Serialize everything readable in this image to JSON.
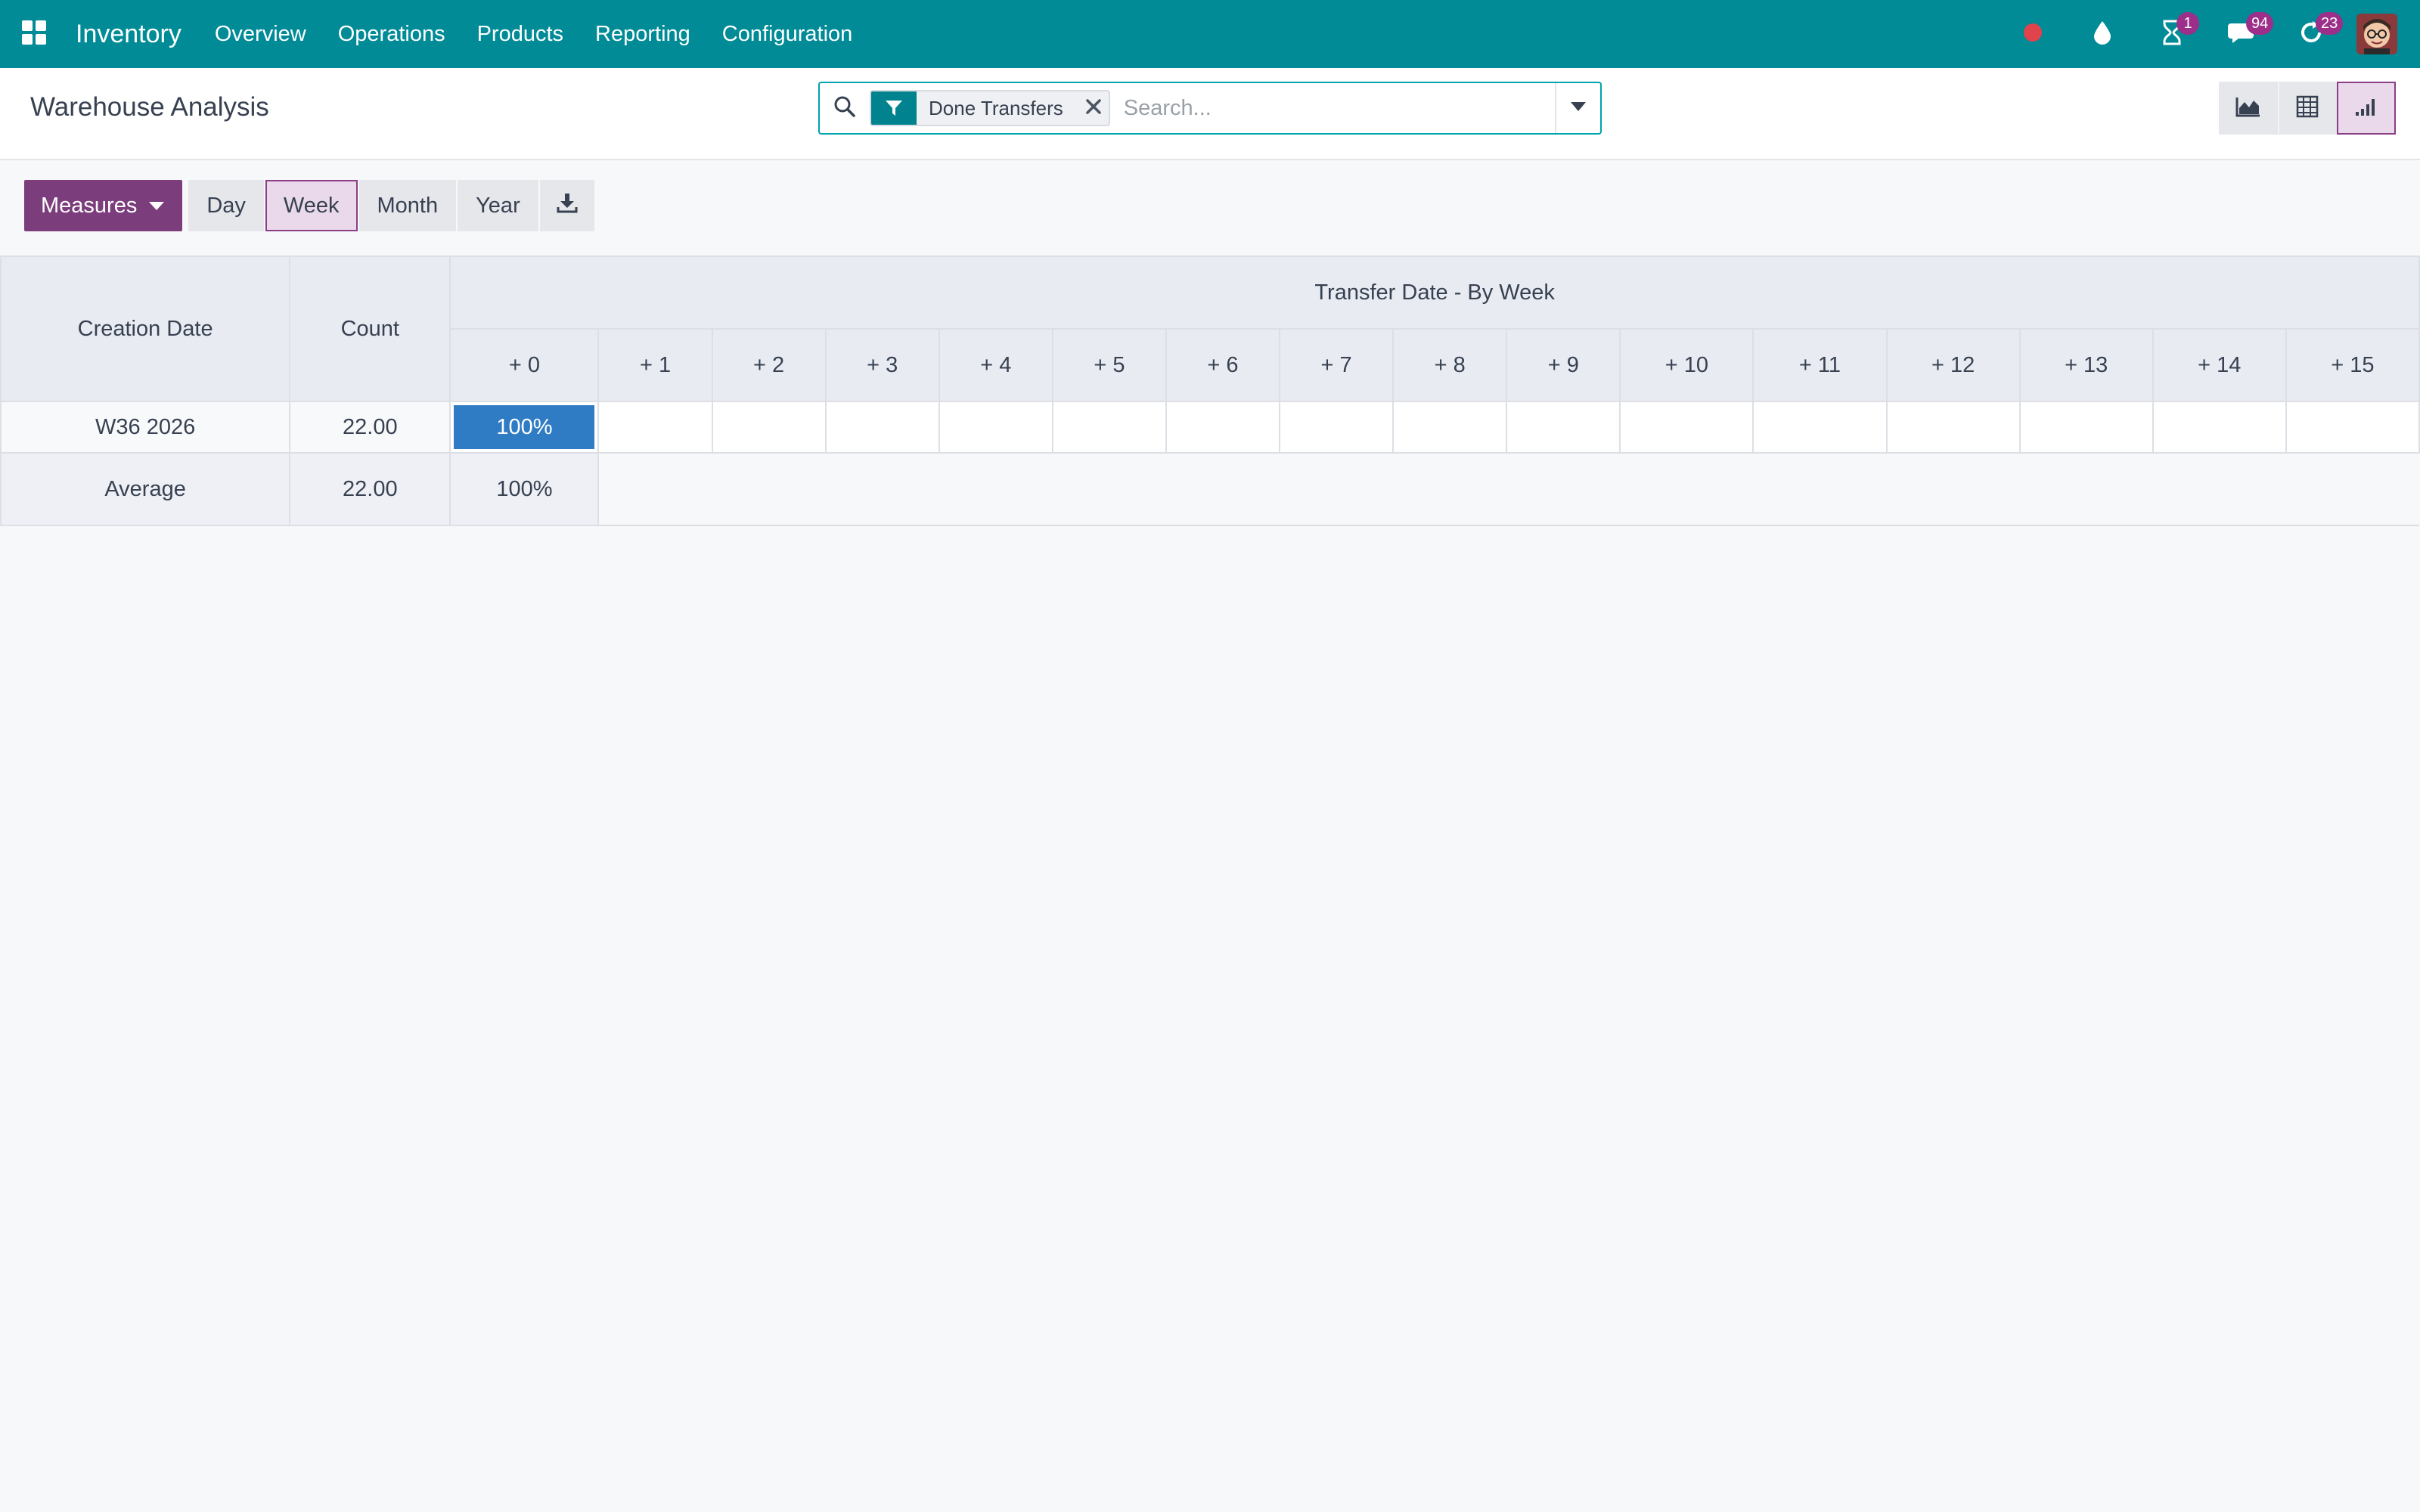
{
  "navbar": {
    "app_name": "Inventory",
    "menu": [
      "Overview",
      "Operations",
      "Products",
      "Reporting",
      "Configuration"
    ],
    "badges": {
      "activities": "1",
      "messages": "94",
      "updates": "23"
    },
    "color": "#008b97"
  },
  "control_panel": {
    "title": "Warehouse Analysis",
    "search": {
      "facet_label": "Done Transfers",
      "placeholder": "Search..."
    },
    "views": [
      "graph-icon",
      "pivot-icon",
      "cohort-icon"
    ],
    "active_view": "cohort"
  },
  "toolbar": {
    "measures_label": "Measures",
    "intervals": [
      "Day",
      "Week",
      "Month",
      "Year"
    ],
    "active_interval": "Week"
  },
  "cohort": {
    "row_header": "Creation Date",
    "count_header": "Count",
    "group_header": "Transfer Date - By Week",
    "columns": [
      "+ 0",
      "+ 1",
      "+ 2",
      "+ 3",
      "+ 4",
      "+ 5",
      "+ 6",
      "+ 7",
      "+ 8",
      "+ 9",
      "+ 10",
      "+ 11",
      "+ 12",
      "+ 13",
      "+ 14",
      "+ 15"
    ],
    "rows": [
      {
        "label": "W36 2026",
        "count": "22.00",
        "values": [
          "100%",
          "",
          "",
          "",
          "",
          "",
          "",
          "",
          "",
          "",
          "",
          "",
          "",
          "",
          "",
          ""
        ],
        "fill": [
          1.0
        ]
      }
    ],
    "average": {
      "label": "Average",
      "count": "22.00",
      "values": [
        "100%"
      ]
    },
    "fill_color": "#2f7bc4"
  }
}
